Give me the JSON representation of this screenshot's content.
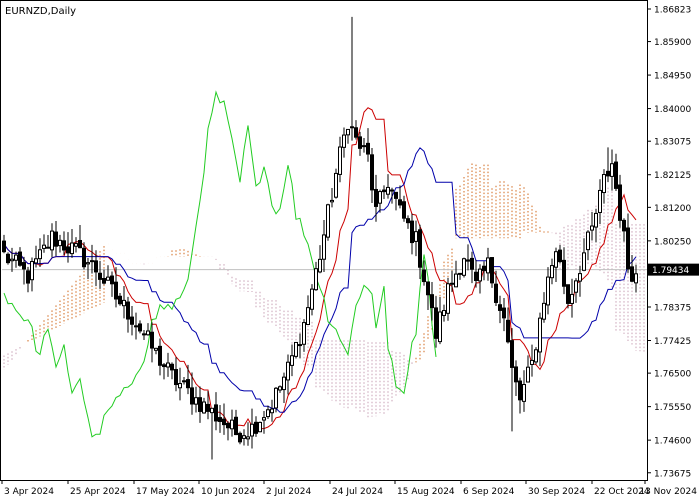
{
  "header": {
    "symbol_label": "EURNZD,Daily"
  },
  "colors": {
    "background": "#ffffff",
    "axis": "#000000",
    "candle": "#000000",
    "tenkan": "#cc0000",
    "kijun": "#0000aa",
    "chikou": "#22cc22",
    "cloud_up": "#d2691e",
    "cloud_down": "#c8a0b4",
    "current_price_bg": "#000000",
    "current_price_line": "#c0c0c0"
  },
  "chart_data": {
    "type": "candlestick",
    "indicator": "Ichimoku Kinko Hyo",
    "symbol": "EURNZD",
    "timeframe": "Daily",
    "ylim": [
      1.7347,
      1.8705
    ],
    "y_ticks": [
      "1.86823",
      "1.85900",
      "1.84950",
      "1.84000",
      "1.83075",
      "1.82125",
      "1.81200",
      "1.80250",
      "1.79434",
      "1.78375",
      "1.77425",
      "1.76500",
      "1.75550",
      "1.74600",
      "1.73675"
    ],
    "x_ticks": [
      "3 Apr 2024",
      "25 Apr 2024",
      "17 May 2024",
      "10 Jun 2024",
      "2 Jul 2024",
      "24 Jul 2024",
      "15 Aug 2024",
      "6 Sep 2024",
      "30 Sep 2024",
      "22 Oct 2024",
      "13 Nov 2024"
    ],
    "current_price": "1.79434",
    "close_anchors": [
      [
        0,
        1.7985
      ],
      [
        6,
        1.7925
      ],
      [
        12,
        1.8035
      ],
      [
        18,
        1.7995
      ],
      [
        23,
        1.7945
      ],
      [
        28,
        1.7865
      ],
      [
        33,
        1.7795
      ],
      [
        38,
        1.7705
      ],
      [
        42,
        1.764
      ],
      [
        48,
        1.7575
      ],
      [
        54,
        1.752
      ],
      [
        58,
        1.748
      ],
      [
        62,
        1.7495
      ],
      [
        67,
        1.7565
      ],
      [
        71,
        1.766
      ],
      [
        75,
        1.779
      ],
      [
        79,
        1.7985
      ],
      [
        83,
        1.8215
      ],
      [
        86,
        1.837
      ],
      [
        88,
        1.831
      ],
      [
        91,
        1.826
      ],
      [
        93,
        1.8105
      ],
      [
        96,
        1.8195
      ],
      [
        99,
        1.8105
      ],
      [
        103,
        1.8025
      ],
      [
        106,
        1.7875
      ],
      [
        108,
        1.776
      ],
      [
        111,
        1.7885
      ],
      [
        115,
        1.7985
      ],
      [
        118,
        1.7895
      ],
      [
        121,
        1.7955
      ],
      [
        125,
        1.7805
      ],
      [
        127,
        1.7655
      ],
      [
        129,
        1.7575
      ],
      [
        132,
        1.7675
      ],
      [
        135,
        1.7865
      ],
      [
        138,
        1.8005
      ],
      [
        141,
        1.7855
      ],
      [
        144,
        1.7955
      ],
      [
        147,
        1.8055
      ],
      [
        150,
        1.8195
      ],
      [
        152,
        1.8245
      ],
      [
        154,
        1.8105
      ],
      [
        156,
        1.7955
      ],
      [
        158,
        1.7925
      ]
    ],
    "chikou_anchors": [
      [
        0,
        1.788
      ],
      [
        3,
        1.783
      ],
      [
        6,
        1.78
      ],
      [
        9,
        1.7695
      ],
      [
        11,
        1.779
      ],
      [
        13,
        1.765
      ],
      [
        15,
        1.772
      ],
      [
        17,
        1.76
      ],
      [
        19,
        1.764
      ],
      [
        21,
        1.751
      ],
      [
        23,
        1.746
      ],
      [
        25,
        1.7515
      ],
      [
        27,
        1.7555
      ],
      [
        29,
        1.7585
      ],
      [
        31,
        1.7595
      ],
      [
        33,
        1.7655
      ],
      [
        35,
        1.77
      ],
      [
        37,
        1.779
      ],
      [
        39,
        1.7835
      ],
      [
        42,
        1.784
      ],
      [
        45,
        1.787
      ],
      [
        47,
        1.7985
      ],
      [
        49,
        1.815
      ],
      [
        51,
        1.8325
      ],
      [
        53,
        1.8435
      ],
      [
        55,
        1.8405
      ],
      [
        57,
        1.83
      ],
      [
        59,
        1.819
      ],
      [
        61,
        1.8345
      ],
      [
        63,
        1.8165
      ],
      [
        65,
        1.8255
      ],
      [
        67,
        1.8125
      ],
      [
        69,
        1.8115
      ],
      [
        71,
        1.8255
      ],
      [
        73,
        1.8095
      ],
      [
        75,
        1.8055
      ],
      [
        79,
        1.7895
      ],
      [
        81,
        1.7815
      ],
      [
        84,
        1.7755
      ],
      [
        86,
        1.7695
      ],
      [
        88,
        1.7855
      ],
      [
        90,
        1.7895
      ],
      [
        92,
        1.7875
      ],
      [
        93,
        1.7785
      ],
      [
        95,
        1.7905
      ],
      [
        96,
        1.7715
      ],
      [
        98,
        1.7625
      ],
      [
        100,
        1.7575
      ],
      [
        102,
        1.7735
      ],
      [
        103,
        1.7775
      ],
      [
        105,
        1.8005
      ],
      [
        108,
        1.7705
      ]
    ],
    "series": [
      {
        "name": "Price (candles)",
        "role": "candles"
      },
      {
        "name": "Tenkan-sen",
        "role": "tenkan",
        "period": 9
      },
      {
        "name": "Kijun-sen",
        "role": "kijun",
        "period": 26
      },
      {
        "name": "Chikou Span",
        "role": "chikou"
      },
      {
        "name": "Senkou Span A/B (cloud)",
        "role": "cloud"
      }
    ],
    "candle_count": 159,
    "grid": false,
    "legend": "none"
  }
}
